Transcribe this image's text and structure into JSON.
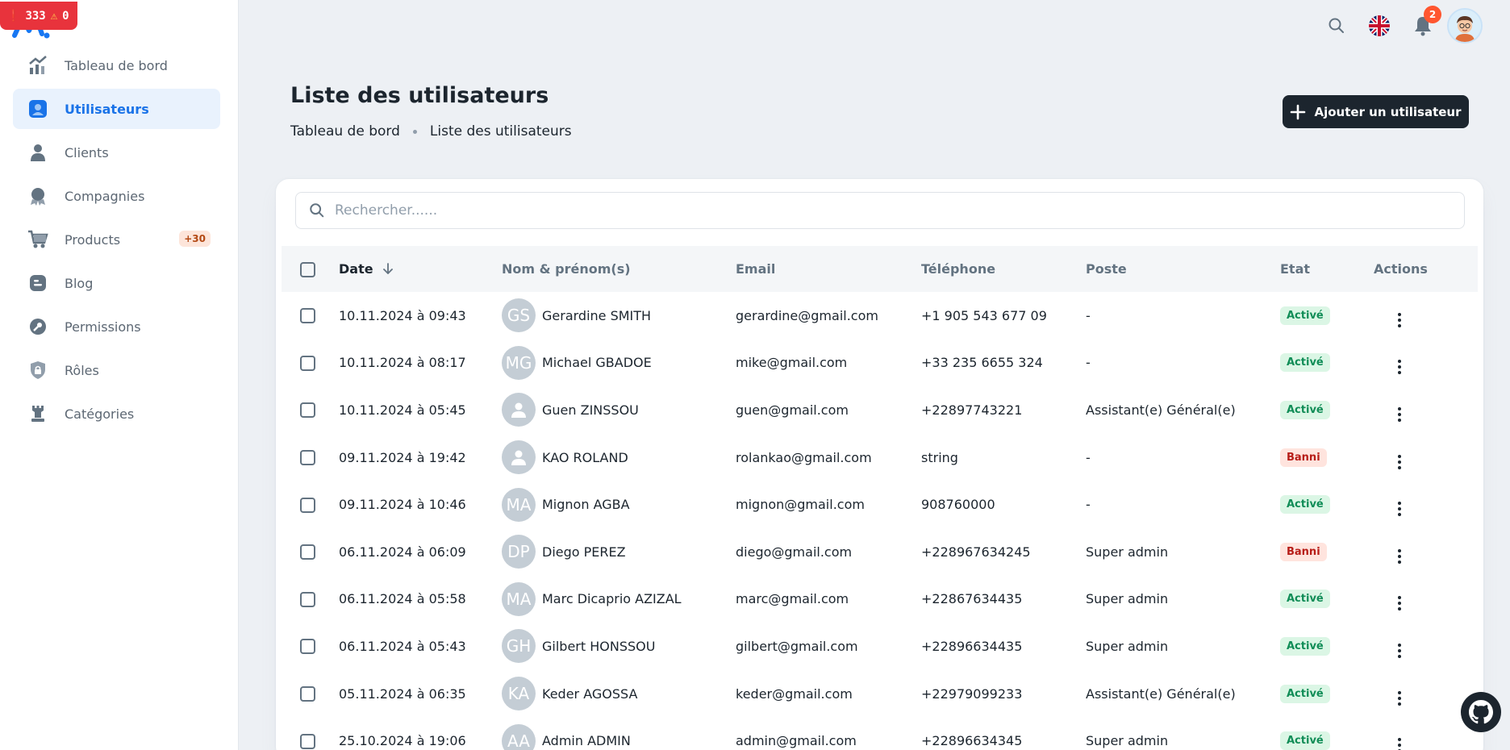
{
  "dev_badge": {
    "errors": "333",
    "warnings": "0"
  },
  "sidebar": {
    "items": [
      {
        "label": "Tableau de bord",
        "icon": "chart-icon"
      },
      {
        "label": "Utilisateurs",
        "icon": "user-card-icon",
        "active": true
      },
      {
        "label": "Clients",
        "icon": "person-icon"
      },
      {
        "label": "Compagnies",
        "icon": "award-icon"
      },
      {
        "label": "Products",
        "icon": "cart-icon",
        "badge": "+30"
      },
      {
        "label": "Blog",
        "icon": "blog-icon"
      },
      {
        "label": "Permissions",
        "icon": "key-icon"
      },
      {
        "label": "Rôles",
        "icon": "shield-lock-icon"
      },
      {
        "label": "Catégories",
        "icon": "rook-icon"
      }
    ]
  },
  "topbar": {
    "notifications_count": "2"
  },
  "header": {
    "title": "Liste des utilisateurs",
    "breadcrumb": [
      "Tableau de bord",
      "Liste des utilisateurs"
    ],
    "add_button": "Ajouter un utilisateur"
  },
  "search": {
    "placeholder": "Rechercher......"
  },
  "table": {
    "columns": [
      "Date",
      "Nom & prénom(s)",
      "Email",
      "Téléphone",
      "Poste",
      "Etat",
      "Actions"
    ],
    "rows": [
      {
        "date": "10.11.2024 à 09:43",
        "initials": "GS",
        "name": "Gerardine SMITH",
        "email": "gerardine@gmail.com",
        "phone": "+1 905 543 677 09",
        "poste": "-",
        "etat": "Activé"
      },
      {
        "date": "10.11.2024 à 08:17",
        "initials": "MG",
        "name": "Michael GBADOE",
        "email": "mike@gmail.com",
        "phone": "+33 235 6655 324",
        "poste": "-",
        "etat": "Activé"
      },
      {
        "date": "10.11.2024 à 05:45",
        "initials": "",
        "name": "Guen ZINSSOU",
        "email": "guen@gmail.com",
        "phone": "+22897743221",
        "poste": "Assistant(e) Général(e)",
        "etat": "Activé"
      },
      {
        "date": "09.11.2024 à 19:42",
        "initials": "",
        "name": "KAO ROLAND",
        "email": "rolankao@gmail.com",
        "phone": "string",
        "poste": "-",
        "etat": "Banni"
      },
      {
        "date": "09.11.2024 à 10:46",
        "initials": "MA",
        "name": "Mignon AGBA",
        "email": "mignon@gmail.com",
        "phone": "908760000",
        "poste": "-",
        "etat": "Activé"
      },
      {
        "date": "06.11.2024 à 06:09",
        "initials": "DP",
        "name": "Diego PEREZ",
        "email": "diego@gmail.com",
        "phone": "+228967634245",
        "poste": "Super admin",
        "etat": "Banni"
      },
      {
        "date": "06.11.2024 à 05:58",
        "initials": "MA",
        "name": "Marc Dicaprio AZIZAL",
        "email": "marc@gmail.com",
        "phone": "+22867634435",
        "poste": "Super admin",
        "etat": "Activé"
      },
      {
        "date": "06.11.2024 à 05:43",
        "initials": "GH",
        "name": "Gilbert HONSSOU",
        "email": "gilbert@gmail.com",
        "phone": "+22896634435",
        "poste": "Super admin",
        "etat": "Activé"
      },
      {
        "date": "05.11.2024 à 06:35",
        "initials": "KA",
        "name": "Keder AGOSSA",
        "email": "keder@gmail.com",
        "phone": "+22979099233",
        "poste": "Assistant(e) Général(e)",
        "etat": "Activé"
      },
      {
        "date": "25.10.2024 à 19:06",
        "initials": "AA",
        "name": "Admin ADMIN",
        "email": "admin@gmail.com",
        "phone": "+22896634345",
        "poste": "Super admin",
        "etat": "Activé"
      }
    ]
  }
}
